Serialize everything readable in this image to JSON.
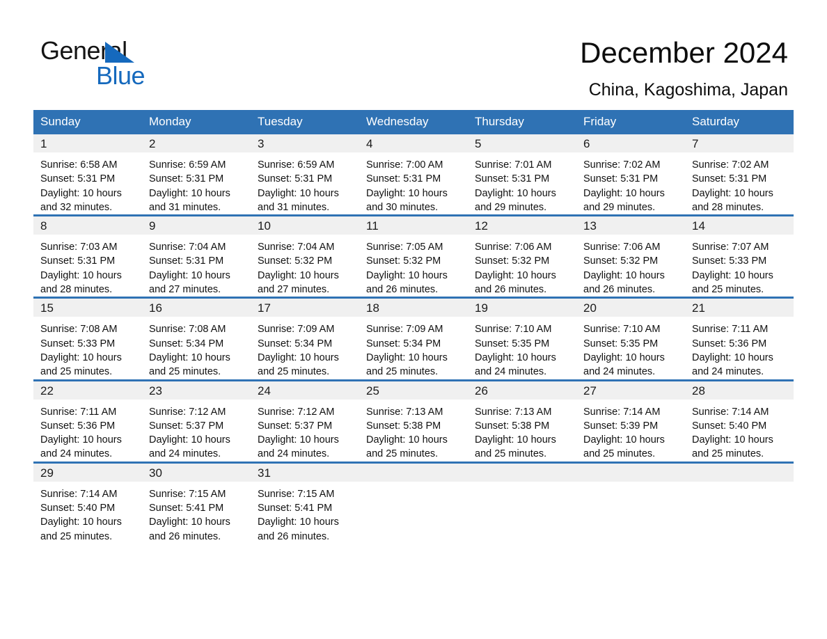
{
  "brand": {
    "word_general": "General",
    "word_blue": "Blue",
    "flag_icon": "triangle-flag-icon",
    "accent_color": "#1569bd"
  },
  "header": {
    "month_title": "December 2024",
    "location": "China, Kagoshima, Japan"
  },
  "calendar": {
    "header_bg": "#2f72b4",
    "daynum_bg": "#f0f0f0",
    "weekdays": [
      "Sunday",
      "Monday",
      "Tuesday",
      "Wednesday",
      "Thursday",
      "Friday",
      "Saturday"
    ],
    "weeks": [
      [
        {
          "day": "1",
          "sunrise": "Sunrise: 6:58 AM",
          "sunset": "Sunset: 5:31 PM",
          "daylight1": "Daylight: 10 hours",
          "daylight2": "and 32 minutes."
        },
        {
          "day": "2",
          "sunrise": "Sunrise: 6:59 AM",
          "sunset": "Sunset: 5:31 PM",
          "daylight1": "Daylight: 10 hours",
          "daylight2": "and 31 minutes."
        },
        {
          "day": "3",
          "sunrise": "Sunrise: 6:59 AM",
          "sunset": "Sunset: 5:31 PM",
          "daylight1": "Daylight: 10 hours",
          "daylight2": "and 31 minutes."
        },
        {
          "day": "4",
          "sunrise": "Sunrise: 7:00 AM",
          "sunset": "Sunset: 5:31 PM",
          "daylight1": "Daylight: 10 hours",
          "daylight2": "and 30 minutes."
        },
        {
          "day": "5",
          "sunrise": "Sunrise: 7:01 AM",
          "sunset": "Sunset: 5:31 PM",
          "daylight1": "Daylight: 10 hours",
          "daylight2": "and 29 minutes."
        },
        {
          "day": "6",
          "sunrise": "Sunrise: 7:02 AM",
          "sunset": "Sunset: 5:31 PM",
          "daylight1": "Daylight: 10 hours",
          "daylight2": "and 29 minutes."
        },
        {
          "day": "7",
          "sunrise": "Sunrise: 7:02 AM",
          "sunset": "Sunset: 5:31 PM",
          "daylight1": "Daylight: 10 hours",
          "daylight2": "and 28 minutes."
        }
      ],
      [
        {
          "day": "8",
          "sunrise": "Sunrise: 7:03 AM",
          "sunset": "Sunset: 5:31 PM",
          "daylight1": "Daylight: 10 hours",
          "daylight2": "and 28 minutes."
        },
        {
          "day": "9",
          "sunrise": "Sunrise: 7:04 AM",
          "sunset": "Sunset: 5:31 PM",
          "daylight1": "Daylight: 10 hours",
          "daylight2": "and 27 minutes."
        },
        {
          "day": "10",
          "sunrise": "Sunrise: 7:04 AM",
          "sunset": "Sunset: 5:32 PM",
          "daylight1": "Daylight: 10 hours",
          "daylight2": "and 27 minutes."
        },
        {
          "day": "11",
          "sunrise": "Sunrise: 7:05 AM",
          "sunset": "Sunset: 5:32 PM",
          "daylight1": "Daylight: 10 hours",
          "daylight2": "and 26 minutes."
        },
        {
          "day": "12",
          "sunrise": "Sunrise: 7:06 AM",
          "sunset": "Sunset: 5:32 PM",
          "daylight1": "Daylight: 10 hours",
          "daylight2": "and 26 minutes."
        },
        {
          "day": "13",
          "sunrise": "Sunrise: 7:06 AM",
          "sunset": "Sunset: 5:32 PM",
          "daylight1": "Daylight: 10 hours",
          "daylight2": "and 26 minutes."
        },
        {
          "day": "14",
          "sunrise": "Sunrise: 7:07 AM",
          "sunset": "Sunset: 5:33 PM",
          "daylight1": "Daylight: 10 hours",
          "daylight2": "and 25 minutes."
        }
      ],
      [
        {
          "day": "15",
          "sunrise": "Sunrise: 7:08 AM",
          "sunset": "Sunset: 5:33 PM",
          "daylight1": "Daylight: 10 hours",
          "daylight2": "and 25 minutes."
        },
        {
          "day": "16",
          "sunrise": "Sunrise: 7:08 AM",
          "sunset": "Sunset: 5:34 PM",
          "daylight1": "Daylight: 10 hours",
          "daylight2": "and 25 minutes."
        },
        {
          "day": "17",
          "sunrise": "Sunrise: 7:09 AM",
          "sunset": "Sunset: 5:34 PM",
          "daylight1": "Daylight: 10 hours",
          "daylight2": "and 25 minutes."
        },
        {
          "day": "18",
          "sunrise": "Sunrise: 7:09 AM",
          "sunset": "Sunset: 5:34 PM",
          "daylight1": "Daylight: 10 hours",
          "daylight2": "and 25 minutes."
        },
        {
          "day": "19",
          "sunrise": "Sunrise: 7:10 AM",
          "sunset": "Sunset: 5:35 PM",
          "daylight1": "Daylight: 10 hours",
          "daylight2": "and 24 minutes."
        },
        {
          "day": "20",
          "sunrise": "Sunrise: 7:10 AM",
          "sunset": "Sunset: 5:35 PM",
          "daylight1": "Daylight: 10 hours",
          "daylight2": "and 24 minutes."
        },
        {
          "day": "21",
          "sunrise": "Sunrise: 7:11 AM",
          "sunset": "Sunset: 5:36 PM",
          "daylight1": "Daylight: 10 hours",
          "daylight2": "and 24 minutes."
        }
      ],
      [
        {
          "day": "22",
          "sunrise": "Sunrise: 7:11 AM",
          "sunset": "Sunset: 5:36 PM",
          "daylight1": "Daylight: 10 hours",
          "daylight2": "and 24 minutes."
        },
        {
          "day": "23",
          "sunrise": "Sunrise: 7:12 AM",
          "sunset": "Sunset: 5:37 PM",
          "daylight1": "Daylight: 10 hours",
          "daylight2": "and 24 minutes."
        },
        {
          "day": "24",
          "sunrise": "Sunrise: 7:12 AM",
          "sunset": "Sunset: 5:37 PM",
          "daylight1": "Daylight: 10 hours",
          "daylight2": "and 24 minutes."
        },
        {
          "day": "25",
          "sunrise": "Sunrise: 7:13 AM",
          "sunset": "Sunset: 5:38 PM",
          "daylight1": "Daylight: 10 hours",
          "daylight2": "and 25 minutes."
        },
        {
          "day": "26",
          "sunrise": "Sunrise: 7:13 AM",
          "sunset": "Sunset: 5:38 PM",
          "daylight1": "Daylight: 10 hours",
          "daylight2": "and 25 minutes."
        },
        {
          "day": "27",
          "sunrise": "Sunrise: 7:14 AM",
          "sunset": "Sunset: 5:39 PM",
          "daylight1": "Daylight: 10 hours",
          "daylight2": "and 25 minutes."
        },
        {
          "day": "28",
          "sunrise": "Sunrise: 7:14 AM",
          "sunset": "Sunset: 5:40 PM",
          "daylight1": "Daylight: 10 hours",
          "daylight2": "and 25 minutes."
        }
      ],
      [
        {
          "day": "29",
          "sunrise": "Sunrise: 7:14 AM",
          "sunset": "Sunset: 5:40 PM",
          "daylight1": "Daylight: 10 hours",
          "daylight2": "and 25 minutes."
        },
        {
          "day": "30",
          "sunrise": "Sunrise: 7:15 AM",
          "sunset": "Sunset: 5:41 PM",
          "daylight1": "Daylight: 10 hours",
          "daylight2": "and 26 minutes."
        },
        {
          "day": "31",
          "sunrise": "Sunrise: 7:15 AM",
          "sunset": "Sunset: 5:41 PM",
          "daylight1": "Daylight: 10 hours",
          "daylight2": "and 26 minutes."
        },
        {
          "day": "",
          "sunrise": "",
          "sunset": "",
          "daylight1": "",
          "daylight2": ""
        },
        {
          "day": "",
          "sunrise": "",
          "sunset": "",
          "daylight1": "",
          "daylight2": ""
        },
        {
          "day": "",
          "sunrise": "",
          "sunset": "",
          "daylight1": "",
          "daylight2": ""
        },
        {
          "day": "",
          "sunrise": "",
          "sunset": "",
          "daylight1": "",
          "daylight2": ""
        }
      ]
    ]
  }
}
